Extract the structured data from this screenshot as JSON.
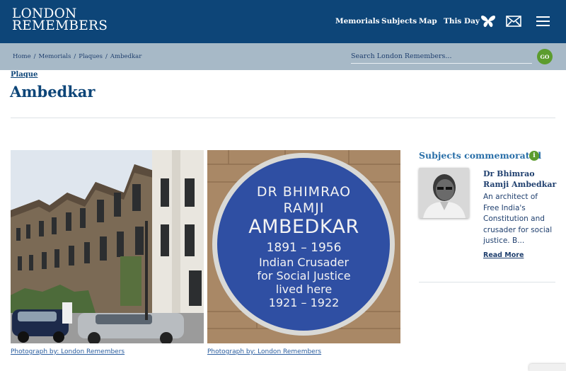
{
  "site": {
    "logo_line1": "LONDON",
    "logo_line2": "REMEMBERS"
  },
  "nav": {
    "items": [
      "Memorials",
      "Subjects",
      "Map",
      "This Day"
    ],
    "icons": [
      "butterfly-icon",
      "mail-icon",
      "menu-icon"
    ]
  },
  "breadcrumb": {
    "items": [
      "Home",
      "Memorials",
      "Plaques",
      "Ambedkar"
    ],
    "separator": "/"
  },
  "search": {
    "placeholder": "Search London Remembers...",
    "go_label": "GO"
  },
  "page": {
    "kind": "Plaque",
    "title": "Ambedkar"
  },
  "photos": [
    {
      "caption": "Photograph by: London Remembers"
    },
    {
      "caption": "Photograph by: London Remembers"
    }
  ],
  "plaque": {
    "line1": "DR BHIMRAO",
    "line2": "RAMJI",
    "line3": "AMBEDKAR",
    "line4": "1891 – 1956",
    "line5": "Indian Crusader",
    "line6": "for Social Justice",
    "line7": "lived here",
    "line8": "1921 – 1922"
  },
  "subjects": {
    "heading": "Subjects commemorated",
    "info_label": "i",
    "person": {
      "name": "Dr Bhimrao Ramji Ambedkar",
      "description": "An architect of Free India's Constitution and crusader for social justice. B...",
      "read_more": "Read More"
    }
  },
  "colors": {
    "header_bg": "#0d4578",
    "crumb_bg": "#a7b9c7",
    "accent_green": "#5c9c2e",
    "plaque_blue": "#2f4fa3"
  }
}
